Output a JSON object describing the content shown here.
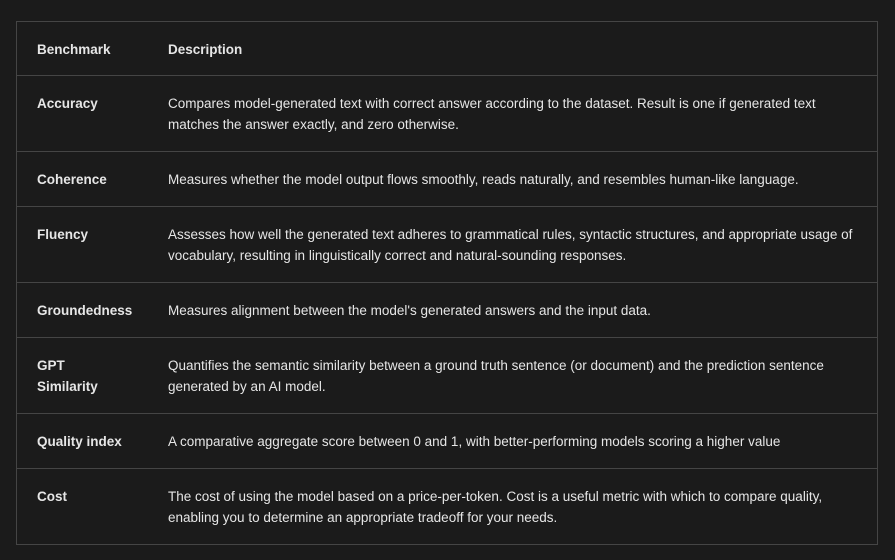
{
  "table": {
    "headers": [
      "Benchmark",
      "Description"
    ],
    "rows": [
      {
        "name": "Accuracy",
        "description": "Compares model-generated text with correct answer according to the dataset. Result is one if generated text matches the answer exactly, and zero otherwise."
      },
      {
        "name": "Coherence",
        "description": "Measures whether the model output flows smoothly, reads naturally, and resembles human-like language."
      },
      {
        "name": "Fluency",
        "description": "Assesses how well the generated text adheres to grammatical rules, syntactic structures, and appropriate usage of vocabulary, resulting in linguistically correct and natural-sounding responses."
      },
      {
        "name": "Groundedness",
        "description": "Measures alignment between the model's generated answers and the input data."
      },
      {
        "name": "GPT Similarity",
        "description": "Quantifies the semantic similarity between a ground truth sentence (or document) and the prediction sentence generated by an AI model."
      },
      {
        "name": "Quality index",
        "description": "A comparative aggregate score between 0 and 1, with better-performing models scoring a higher value"
      },
      {
        "name": "Cost",
        "description": "The cost of using the model based on a price-per-token. Cost is a useful metric with which to compare quality, enabling you to determine an appropriate tradeoff for your needs."
      }
    ]
  }
}
